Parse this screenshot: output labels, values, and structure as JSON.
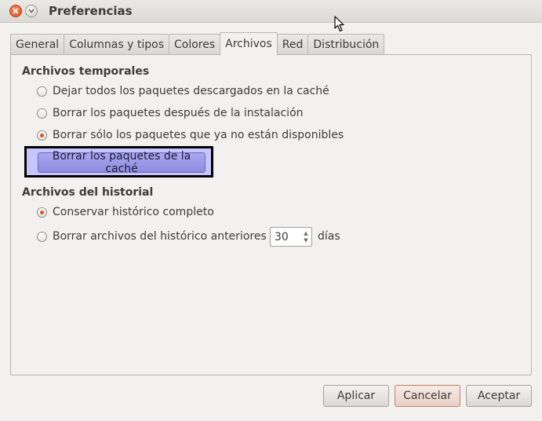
{
  "window": {
    "title": "Preferencias"
  },
  "tabs": [
    {
      "label": "General",
      "active": false
    },
    {
      "label": "Columnas y tipos",
      "active": false
    },
    {
      "label": "Colores",
      "active": false
    },
    {
      "label": "Archivos",
      "active": true
    },
    {
      "label": "Red",
      "active": false
    },
    {
      "label": "Distribución",
      "active": false
    }
  ],
  "temp_files": {
    "title": "Archivos temporales",
    "options": [
      {
        "label": "Dejar todos los paquetes descargados en la caché",
        "checked": false
      },
      {
        "label": "Borrar los paquetes después de la instalación",
        "checked": false
      },
      {
        "label": "Borrar sólo los paquetes que ya no están disponibles",
        "checked": true
      }
    ],
    "purge_button": "Borrar los paquetes de la caché"
  },
  "history": {
    "title": "Archivos del historial",
    "options": [
      {
        "label": "Conservar histórico completo",
        "checked": true
      },
      {
        "label": "Borrar archivos del histórico anteriores a:",
        "checked": false
      }
    ],
    "days_value": "30",
    "days_unit": "días"
  },
  "buttons": {
    "apply": "Aplicar",
    "cancel": "Cancelar",
    "accept": "Aceptar"
  },
  "colors": {
    "accent_radio": "#e0531b",
    "highlight": "#c6c5ff",
    "close_button": "#df4b1a"
  }
}
